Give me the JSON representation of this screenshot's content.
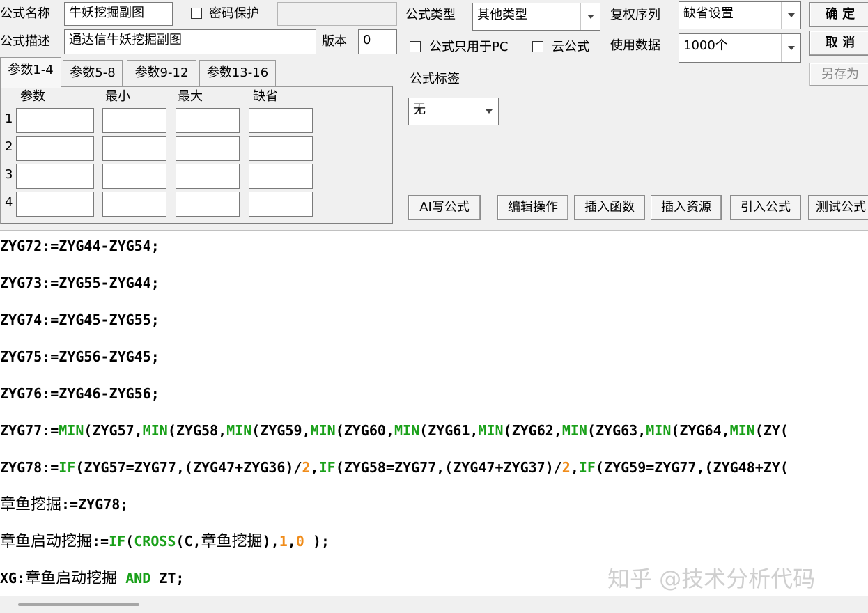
{
  "header": {
    "name_label": "公式名称",
    "name_value": "牛妖挖掘副图",
    "password_label": "密码保护",
    "password_value": "",
    "desc_label": "公式描述",
    "desc_value": "通达信牛妖挖掘副图",
    "version_label": "版本",
    "version_value": "0"
  },
  "options": {
    "type_label": "公式类型",
    "type_value": "其他类型",
    "rights_label": "复权序列",
    "rights_value": "缺省设置",
    "pc_only_label": "公式只用于PC",
    "cloud_label": "云公式",
    "data_label": "使用数据",
    "data_value": "1000个",
    "tag_label": "公式标签",
    "tag_value": "无"
  },
  "buttons": {
    "ok": "确 定",
    "cancel": "取 消",
    "save_as": "另存为",
    "ai": "AI写公式",
    "edit_ops": "编辑操作",
    "insert_fn": "插入函数",
    "insert_res": "插入资源",
    "import": "引入公式",
    "test": "测试公式"
  },
  "tabs": [
    "参数1-4",
    "参数5-8",
    "参数9-12",
    "参数13-16"
  ],
  "params": {
    "headers": [
      "参数",
      "最小",
      "最大",
      "缺省"
    ],
    "rows": [
      "1",
      "2",
      "3",
      "4"
    ]
  },
  "code": {
    "l1": "ZYG72:=ZYG44-ZYG54;",
    "l2": "ZYG73:=ZYG55-ZYG44;",
    "l3": "ZYG74:=ZYG45-ZYG55;",
    "l4": "ZYG75:=ZYG56-ZYG45;",
    "l5": "ZYG76:=ZYG46-ZYG56;",
    "l6": {
      "a": "ZYG77:=",
      "f1": "MIN",
      "b": "(ZYG57,",
      "f2": "MIN",
      "c": "(ZYG58,",
      "f3": "MIN",
      "d": "(ZYG59,",
      "f4": "MIN",
      "e": "(ZYG60,",
      "f5": "MIN",
      "f": "(ZYG61,",
      "f6": "MIN",
      "g": "(ZYG62,",
      "f7": "MIN",
      "h": "(ZYG63,",
      "f8": "MIN",
      "i": "(ZYG64,",
      "f9": "MIN",
      "j": "(ZY("
    },
    "l7": {
      "a": "ZYG78:=",
      "f1": "IF",
      "b": "(ZYG57=ZYG77,(ZYG47+ZYG36)/",
      "n1": "2",
      "c": ",",
      "f2": "IF",
      "d": "(ZYG58=ZYG77,(ZYG47+ZYG37)/",
      "n2": "2",
      "e": ",",
      "f3": "IF",
      "f": "(ZYG59=ZYG77,(ZYG48+ZY("
    },
    "l8": {
      "zh": "章鱼挖掘",
      "rest": ":=ZYG78;"
    },
    "l9": {
      "zh1": "章鱼启动挖掘",
      "a": ":=",
      "f1": "IF",
      "b": "(",
      "f2": "CROSS",
      "c": "(C,",
      "zh2": "章鱼挖掘",
      "d": "),",
      "n1": "1",
      "e": ",",
      "n2": "0",
      "g": " );"
    },
    "l10": {
      "a": "XG:",
      "zh": "章鱼启动挖掘",
      "sp": " ",
      "f1": "AND",
      "b": " ZT;"
    }
  },
  "watermark": "知乎 @技术分析代码"
}
